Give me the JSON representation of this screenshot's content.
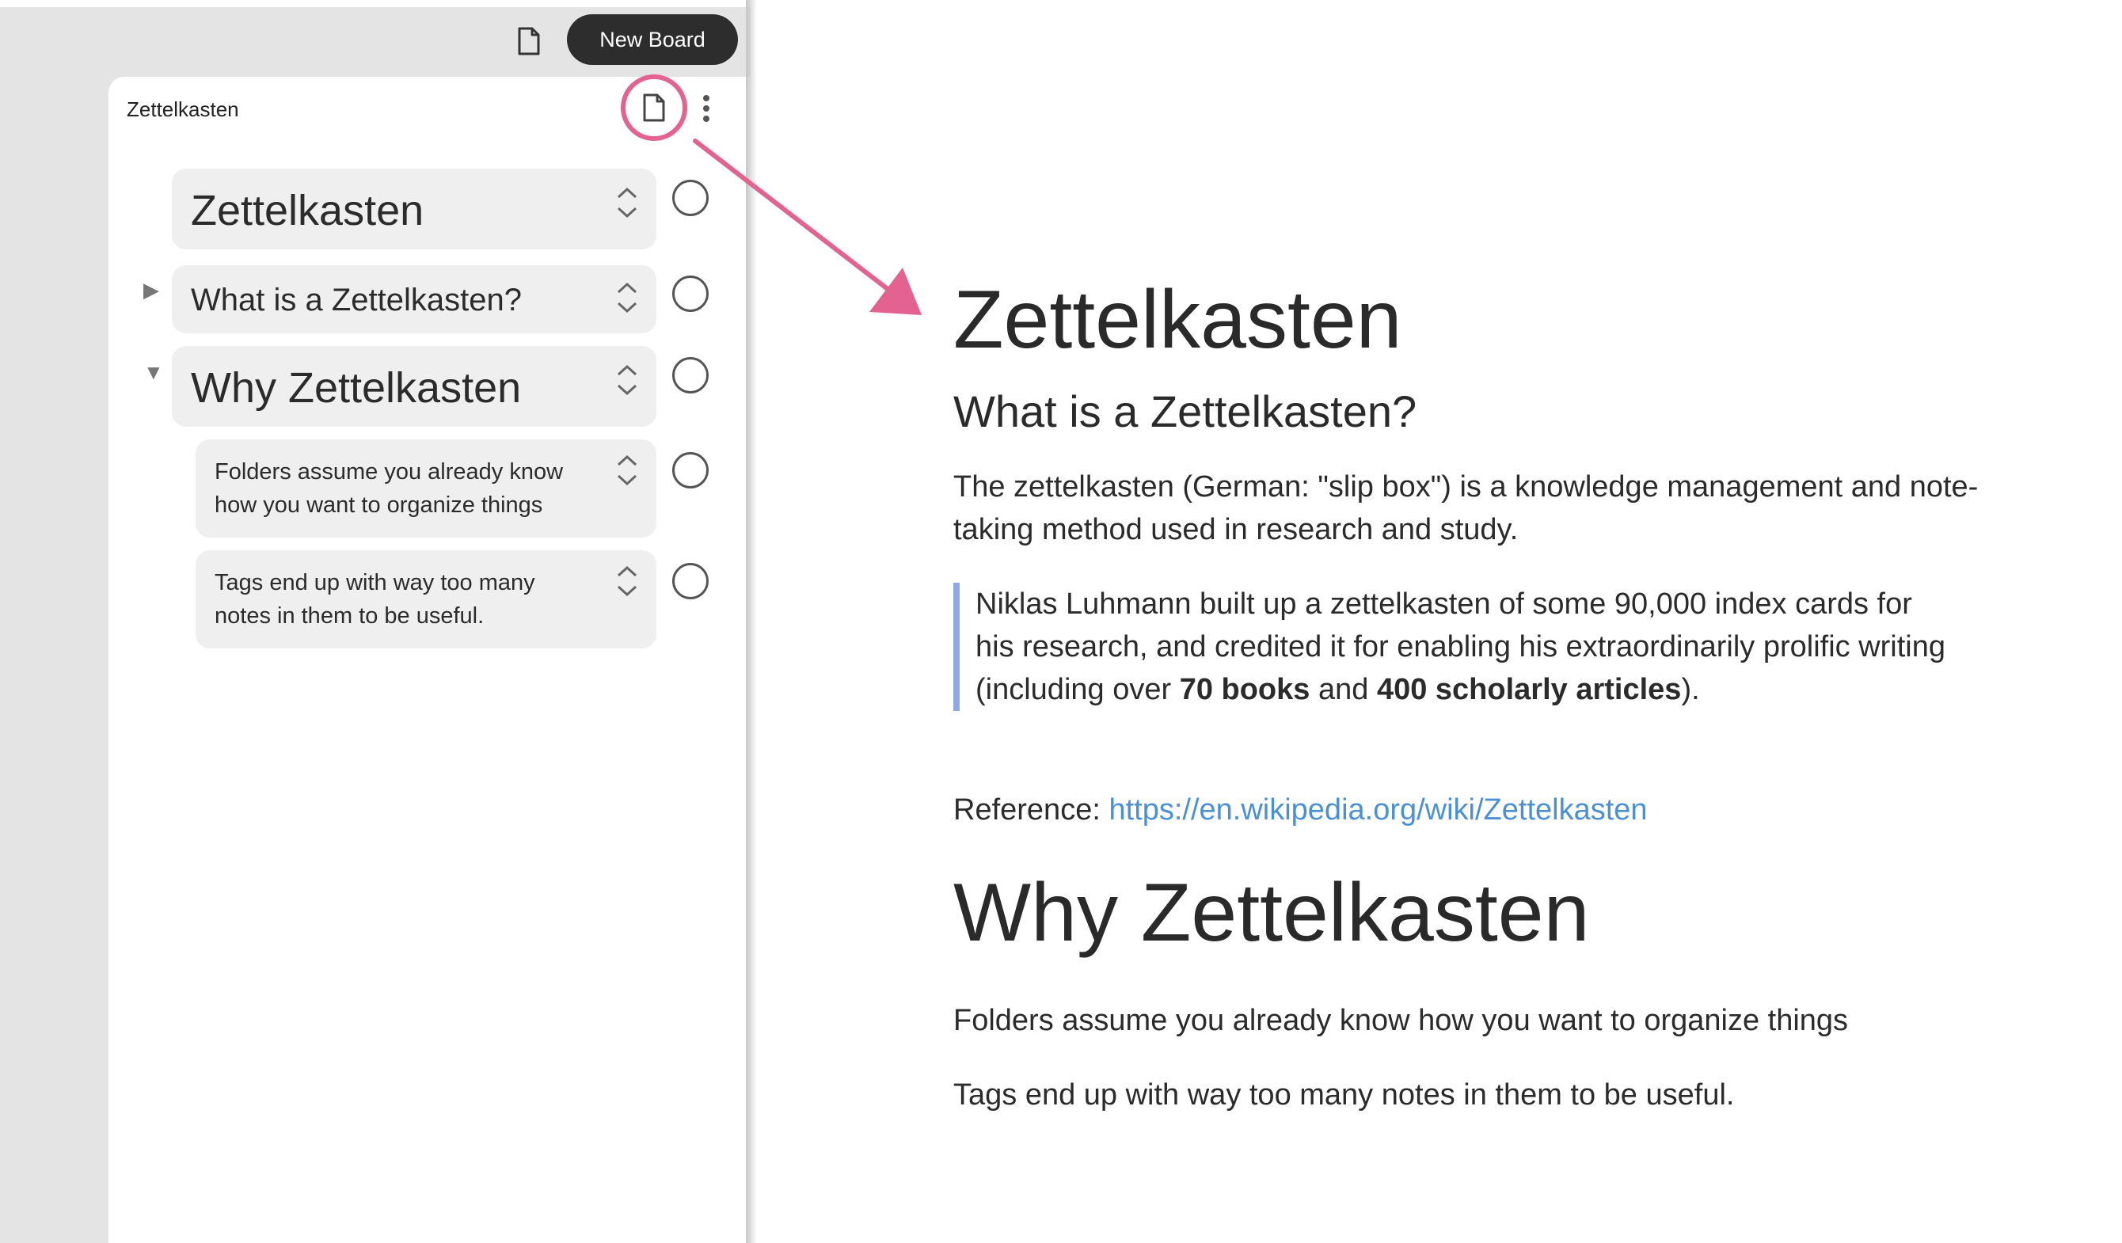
{
  "toolbar": {
    "page_icon": "document-icon",
    "new_board_label": "New Board"
  },
  "board": {
    "title": "Zettelkasten",
    "doc_icon": "document-icon",
    "menu_icon": "vertical-ellipsis-icon",
    "nodes": [
      {
        "text": "Zettelkasten",
        "level": 0,
        "toggle": ""
      },
      {
        "text": "What is a Zettelkasten?",
        "level": 0,
        "toggle": "▶"
      },
      {
        "text": "Why Zettelkasten",
        "level": 0,
        "toggle": "▼"
      },
      {
        "text": "Folders assume you already know how you want to organize things",
        "level": 1,
        "toggle": ""
      },
      {
        "text": "Tags end up with way too many notes in them to be useful.",
        "level": 1,
        "toggle": ""
      }
    ]
  },
  "document": {
    "h1_first": "Zettelkasten",
    "h2": "What is a Zettelkasten?",
    "paragraph1": "The zettelkasten (German: \"slip box\") is a knowledge management and note-taking method used in research and study.",
    "quote": {
      "part1": "Niklas Luhmann built up a zettelkasten of some 90,000 index cards for his research, and credited it for enabling his extraordinarily prolific writing (including over ",
      "bold1": "70 books",
      "part2": " and ",
      "bold2": "400 scholarly articles",
      "part3": ")."
    },
    "reference_label": "Reference: ",
    "reference_link": "https://en.wikipedia.org/wiki/Zettelkasten",
    "h1_second": "Why Zettelkasten",
    "paragraph2": "Folders assume you already know how you want to organize things",
    "paragraph3": "Tags end up with way too many notes in them to be useful."
  },
  "colors": {
    "highlight": "#e4628f",
    "link": "#4a90d9",
    "quote_bar": "#8ea7e5",
    "button_dark": "#2d2d2d"
  }
}
